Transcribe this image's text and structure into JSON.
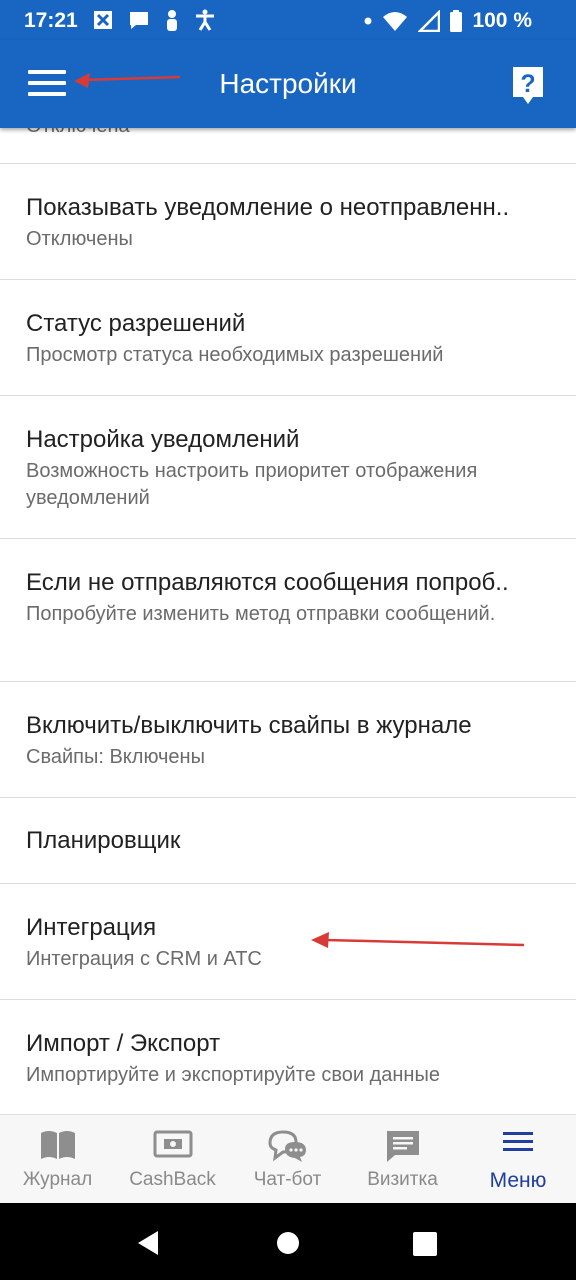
{
  "status_bar": {
    "time": "17:21",
    "battery": "100 %"
  },
  "app_bar": {
    "title": "Настройки"
  },
  "settings": [
    {
      "title": "",
      "subtitle": "Отключена"
    },
    {
      "title": "Показывать уведомление о неотправленн..",
      "subtitle": "Отключены"
    },
    {
      "title": "Статус разрешений",
      "subtitle": "Просмотр статуса необходимых разрешений"
    },
    {
      "title": "Настройка уведомлений",
      "subtitle": "Возможность настроить приоритет отображения уведомлений"
    },
    {
      "title": "Если не отправляются сообщения попроб..",
      "subtitle": "Попробуйте изменить метод отправки сообщений."
    },
    {
      "title": "Включить/выключить свайпы в журнале",
      "subtitle": "Свайпы: Включены"
    },
    {
      "title": "Планировщик",
      "subtitle": ""
    },
    {
      "title": "Интеграция",
      "subtitle": "Интеграция с CRM и АТС"
    },
    {
      "title": "Импорт / Экспорт",
      "subtitle": "Импортируйте и экспортируйте свои данные"
    }
  ],
  "bottom_nav": {
    "tabs": [
      {
        "label": "Журнал",
        "icon": "book-icon"
      },
      {
        "label": "CashBack",
        "icon": "banknote-icon"
      },
      {
        "label": "Чат-бот",
        "icon": "chat-bubbles-icon"
      },
      {
        "label": "Визитка",
        "icon": "message-card-icon"
      },
      {
        "label": "Меню",
        "icon": "hamburger-icon"
      }
    ],
    "active_index": 4
  },
  "colors": {
    "primary": "#1866c2",
    "active_tab": "#1f3e9e",
    "annotation_arrow": "#d93a36"
  }
}
